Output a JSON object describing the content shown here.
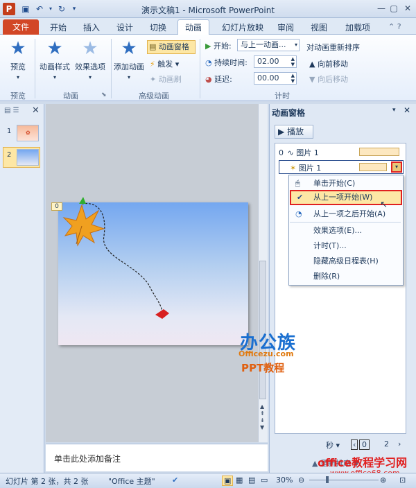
{
  "window": {
    "title": "演示文稿1 - Microsoft PowerPoint",
    "app_logo": "P"
  },
  "tabs": [
    "文件",
    "开始",
    "插入",
    "设计",
    "切换",
    "动画",
    "幻灯片放映",
    "审阅",
    "视图",
    "加载项"
  ],
  "ribbon": {
    "preview": {
      "label": "预览",
      "group": "预览"
    },
    "anim_style": "动画样式",
    "effect_options": "效果选项",
    "anim_group": "动画",
    "add_anim": "添加动画",
    "anim_pane_btn": "动画窗格",
    "trigger": "触发",
    "anim_painter": "动画刷",
    "adv_group": "高级动画",
    "start_label": "开始:",
    "start_value": "与上一动画...",
    "duration_label": "持续时间:",
    "duration_value": "02.00",
    "delay_label": "延迟:",
    "delay_value": "00.00",
    "reorder": "对动画重新排序",
    "move_earlier": "向前移动",
    "move_later": "向后移动",
    "timing_group": "计时"
  },
  "slides": [
    {
      "num": "1"
    },
    {
      "num": "2"
    }
  ],
  "slide": {
    "anim_tag": "0"
  },
  "notes": {
    "placeholder": "单击此处添加备注"
  },
  "pane": {
    "title": "动画窗格",
    "play": "播放",
    "items": [
      {
        "num": "0",
        "label": "图片 1"
      },
      {
        "num": "",
        "label": "图片 1"
      }
    ],
    "timeline_unit": "秒",
    "timeline_ticks": [
      "0",
      "2"
    ],
    "reorder_label": "重新排序"
  },
  "menu": [
    {
      "label": "单击开始(C)",
      "icon": "mouse-icon"
    },
    {
      "label": "从上一项开始(W)",
      "icon": "check-icon"
    },
    {
      "label": "从上一项之后开始(A)",
      "icon": "clock-icon"
    },
    {
      "label": "效果选项(E)..."
    },
    {
      "label": "计时(T)..."
    },
    {
      "label": "隐藏高级日程表(H)"
    },
    {
      "label": "删除(R)"
    }
  ],
  "status": {
    "slide": "幻灯片 第 2 张，共 2 张",
    "theme": "\"Office 主题\"",
    "zoom": "30%"
  },
  "watermark": {
    "brand_cn": "办公族",
    "brand_url": "Officezu.com",
    "brand_tut": "PPT教程",
    "site_name": "office教程学习网",
    "site_url": "www.office68.com"
  },
  "colors": {
    "accent": "#d24726",
    "selection": "#ffe8a6",
    "highlight_border": "#e02020"
  }
}
